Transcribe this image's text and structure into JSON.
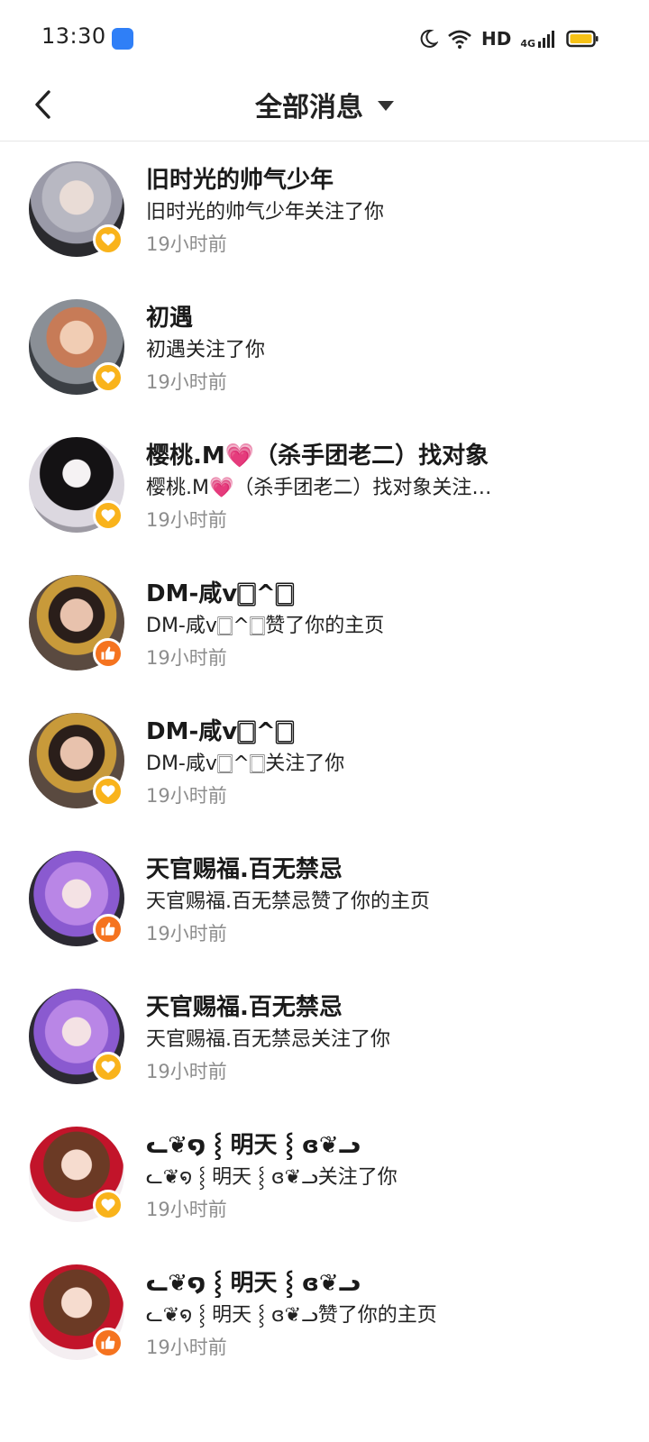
{
  "status_bar": {
    "time": "13:30",
    "hd_label": "HD",
    "network_label": "4G",
    "icons": [
      "app-notification-icon",
      "moon-icon",
      "wifi-icon",
      "signal-icon",
      "battery-icon"
    ]
  },
  "header": {
    "title": "全部消息",
    "back_icon": "chevron-left-icon",
    "dropdown_icon": "caret-down-icon"
  },
  "colors": {
    "follow_badge": "#f9b31b",
    "like_badge": "#f5731f",
    "time_text": "#8d8d8d"
  },
  "messages": [
    {
      "name": "旧时光的帅气少年",
      "text": "旧时光的帅气少年关注了你",
      "time": "19小时前",
      "type": "follow",
      "badge_icon": "heart-icon"
    },
    {
      "name": "初遇",
      "text": "初遇关注了你",
      "time": "19小时前",
      "type": "follow",
      "badge_icon": "heart-icon"
    },
    {
      "name": "樱桃.M💗（杀手团老二）找对象",
      "text": "樱桃.M💗（杀手团老二）找对象关注了你",
      "time": "19小时前",
      "type": "follow",
      "badge_icon": "heart-icon"
    },
    {
      "name": "DM-咸v🀆^🀆",
      "text": "DM-咸v🀆^🀆赞了你的主页",
      "time": "19小时前",
      "type": "like",
      "badge_icon": "thumbs-up-icon"
    },
    {
      "name": "DM-咸v🀆^🀆",
      "text": "DM-咸v🀆^🀆关注了你",
      "time": "19小时前",
      "type": "follow",
      "badge_icon": "heart-icon"
    },
    {
      "name": "天官赐福.百无禁忌",
      "text": "天官赐福.百无禁忌赞了你的主页",
      "time": "19小时前",
      "type": "like",
      "badge_icon": "thumbs-up-icon"
    },
    {
      "name": "天官赐福.百无禁忌",
      "text": "天官赐福.百无禁忌关注了你",
      "time": "19小时前",
      "type": "follow",
      "badge_icon": "heart-icon"
    },
    {
      "name": "ᓚ❦໑ ⸾ 明天 ⸾ ɞ❦ᓗ",
      "text": "ᓚ❦໑ ⸾ 明天 ⸾ ɞ❦ᓗ关注了你",
      "time": "19小时前",
      "type": "follow",
      "badge_icon": "heart-icon"
    },
    {
      "name": "ᓚ❦໑ ⸾ 明天 ⸾ ɞ❦ᓗ",
      "text": "ᓚ❦໑ ⸾ 明天 ⸾ ɞ❦ᓗ赞了你的主页",
      "time": "19小时前",
      "type": "like",
      "badge_icon": "thumbs-up-icon"
    }
  ]
}
